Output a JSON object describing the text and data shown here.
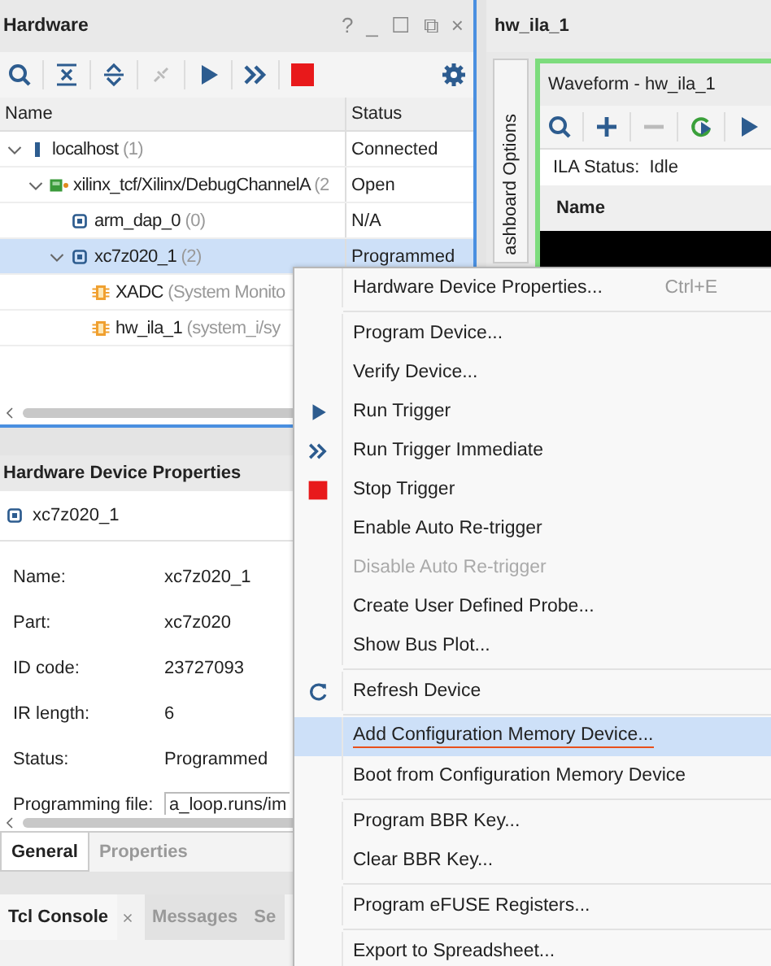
{
  "hardware": {
    "title": "Hardware",
    "window_controls": [
      "?",
      "_",
      "☐",
      "⧉",
      "×"
    ],
    "columns": [
      "Name",
      "Status"
    ],
    "tree": [
      {
        "kind": "host",
        "name": "localhost",
        "count": "(1)",
        "status": "Connected",
        "expanded": true,
        "selected": false,
        "children": [
          {
            "kind": "board",
            "name": "xilinx_tcf/Xilinx/DebugChannelA",
            "count": "(2",
            "status": "Open",
            "expanded": true,
            "selected": false,
            "children": [
              {
                "kind": "chip",
                "name": "arm_dap_0",
                "count": "(0)",
                "status": "N/A",
                "selected": false
              },
              {
                "kind": "chip",
                "name": "xc7z020_1",
                "count": "(2)",
                "status": "Programmed",
                "expanded": true,
                "selected": true,
                "children": [
                  {
                    "kind": "core",
                    "name": "XADC",
                    "count": "(System Monito",
                    "selected": false
                  },
                  {
                    "kind": "core",
                    "name": "hw_ila_1",
                    "count": "(system_i/sy",
                    "selected": false
                  }
                ]
              }
            ]
          }
        ]
      }
    ]
  },
  "properties": {
    "title": "Hardware Device Properties",
    "device": "xc7z020_1",
    "fields": [
      {
        "label": "Name:",
        "value": "xc7z020_1"
      },
      {
        "label": "Part:",
        "value": "xc7z020"
      },
      {
        "label": "ID code:",
        "value": "23727093"
      },
      {
        "label": "IR length:",
        "value": "6"
      },
      {
        "label": "Status:",
        "value": "Programmed"
      },
      {
        "label": "Programming file:",
        "value": "a_loop.runs/im",
        "kind": "field"
      }
    ],
    "tabs": [
      {
        "label": "General",
        "selected": true
      },
      {
        "label": "Properties",
        "selected": false
      }
    ]
  },
  "console": {
    "tabs": [
      {
        "label": "Tcl Console",
        "selected": true,
        "closable": true
      },
      {
        "label": "Messages",
        "selected": false,
        "closable": false
      },
      {
        "label": "Se",
        "selected": false,
        "closable": false
      }
    ]
  },
  "ila": {
    "title": "hw_ila_1",
    "side_tab": "ashboard Options",
    "waveform": {
      "title": "Waveform - hw_ila_1",
      "status_label": "ILA Status:",
      "status_value": "Idle",
      "column": "Name"
    }
  },
  "menu": [
    {
      "kind": "item",
      "label": "Hardware Device Properties...",
      "shortcut": "Ctrl+E",
      "disabled": false,
      "selected": false
    },
    {
      "kind": "separator"
    },
    {
      "kind": "item",
      "label": "Program Device...",
      "disabled": false,
      "selected": false
    },
    {
      "kind": "item",
      "label": "Verify Device...",
      "disabled": false,
      "selected": false
    },
    {
      "kind": "trigger",
      "label": "Run Trigger",
      "disabled": false,
      "selected": false
    },
    {
      "kind": "trigger-immediate",
      "label": "Run Trigger Immediate",
      "disabled": false,
      "selected": false
    },
    {
      "kind": "stop",
      "label": "Stop Trigger",
      "disabled": false,
      "selected": false
    },
    {
      "kind": "item",
      "label": "Enable Auto Re-trigger",
      "disabled": false,
      "selected": false
    },
    {
      "kind": "item",
      "label": "Disable Auto Re-trigger",
      "disabled": true,
      "selected": false
    },
    {
      "kind": "item",
      "label": "Create User Defined Probe...",
      "disabled": false,
      "selected": false
    },
    {
      "kind": "item",
      "label": "Show Bus Plot...",
      "disabled": false,
      "selected": false
    },
    {
      "kind": "separator"
    },
    {
      "kind": "refresh",
      "label": "Refresh Device",
      "disabled": false,
      "selected": false
    },
    {
      "kind": "separator"
    },
    {
      "kind": "item",
      "label": "Add Configuration Memory Device...",
      "disabled": false,
      "selected": true,
      "underlined": true
    },
    {
      "kind": "item",
      "label": "Boot from Configuration Memory Device",
      "disabled": false,
      "selected": false
    },
    {
      "kind": "separator"
    },
    {
      "kind": "item",
      "label": "Program BBR Key...",
      "disabled": false,
      "selected": false
    },
    {
      "kind": "item",
      "label": "Clear BBR Key...",
      "disabled": false,
      "selected": false
    },
    {
      "kind": "separator"
    },
    {
      "kind": "item",
      "label": "Program eFUSE Registers...",
      "disabled": false,
      "selected": false
    },
    {
      "kind": "separator"
    },
    {
      "kind": "item",
      "label": "Export to Spreadsheet...",
      "disabled": false,
      "selected": false
    }
  ]
}
